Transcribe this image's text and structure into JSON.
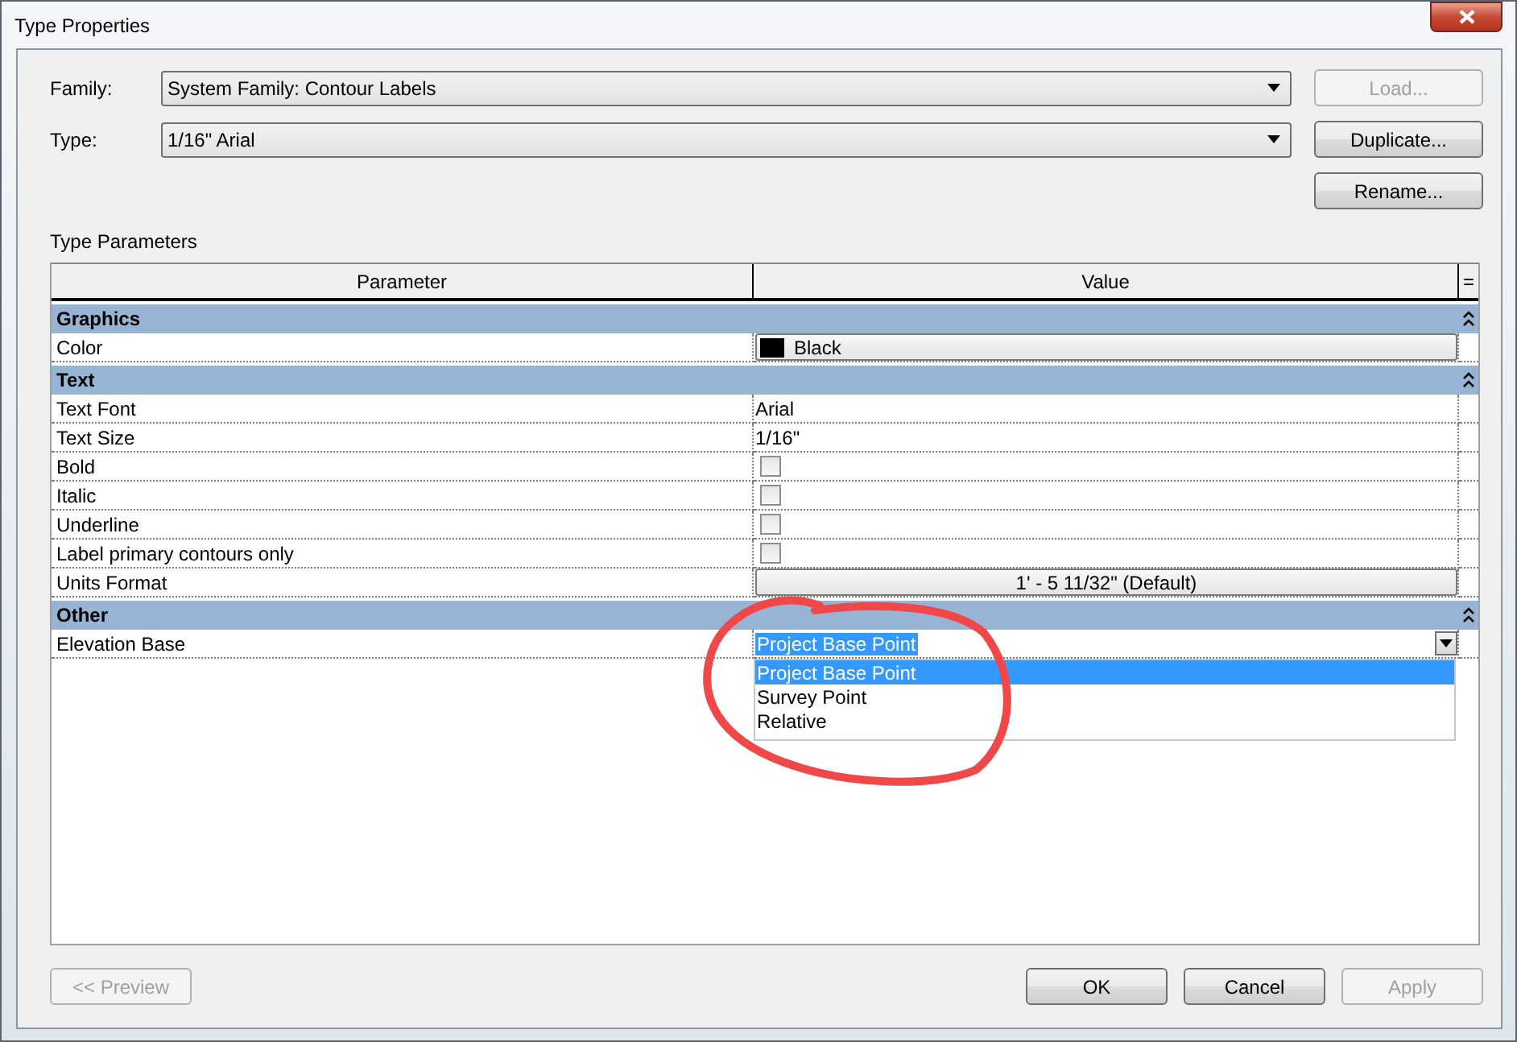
{
  "window": {
    "title": "Type Properties"
  },
  "family": {
    "label": "Family:",
    "value": "System Family: Contour Labels"
  },
  "type": {
    "label": "Type:",
    "value": "1/16\" Arial"
  },
  "side_buttons": [
    {
      "label": "Load...",
      "disabled": true
    },
    {
      "label": "Duplicate...",
      "disabled": false
    },
    {
      "label": "Rename...",
      "disabled": false
    }
  ],
  "section_label": "Type Parameters",
  "table": {
    "columns": [
      "Parameter",
      "Value"
    ],
    "column_3": "=",
    "groups": [
      {
        "name": "Graphics",
        "expanded": true,
        "rows": [
          {
            "name": "Color",
            "kind": "swatch",
            "value": "Black",
            "color": "#000000"
          }
        ]
      },
      {
        "name": "Text",
        "expanded": true,
        "rows": [
          {
            "name": "Text Font",
            "kind": "text",
            "value": "Arial"
          },
          {
            "name": "Text Size",
            "kind": "text",
            "value": "1/16\""
          },
          {
            "name": "Bold",
            "kind": "checkbox",
            "checked": false
          },
          {
            "name": "Italic",
            "kind": "checkbox",
            "checked": false
          },
          {
            "name": "Underline",
            "kind": "checkbox",
            "checked": false
          },
          {
            "name": "Label primary contours only",
            "kind": "checkbox",
            "checked": false
          },
          {
            "name": "Units Format",
            "kind": "button",
            "value": "1' - 5 11/32\" (Default)"
          }
        ]
      },
      {
        "name": "Other",
        "expanded": true,
        "rows": [
          {
            "name": "Elevation Base",
            "kind": "dropdown",
            "value": "Project Base Point",
            "expanded": true,
            "options": [
              {
                "label": "Project Base Point",
                "selected": true
              },
              {
                "label": "Survey Point",
                "selected": false
              },
              {
                "label": "Relative",
                "selected": false
              }
            ]
          }
        ]
      }
    ]
  },
  "footer": {
    "preview": {
      "label": "<< Preview",
      "disabled": true
    },
    "buttons": [
      {
        "label": "OK",
        "disabled": false
      },
      {
        "label": "Cancel",
        "disabled": false
      },
      {
        "label": "Apply",
        "disabled": true
      }
    ]
  }
}
